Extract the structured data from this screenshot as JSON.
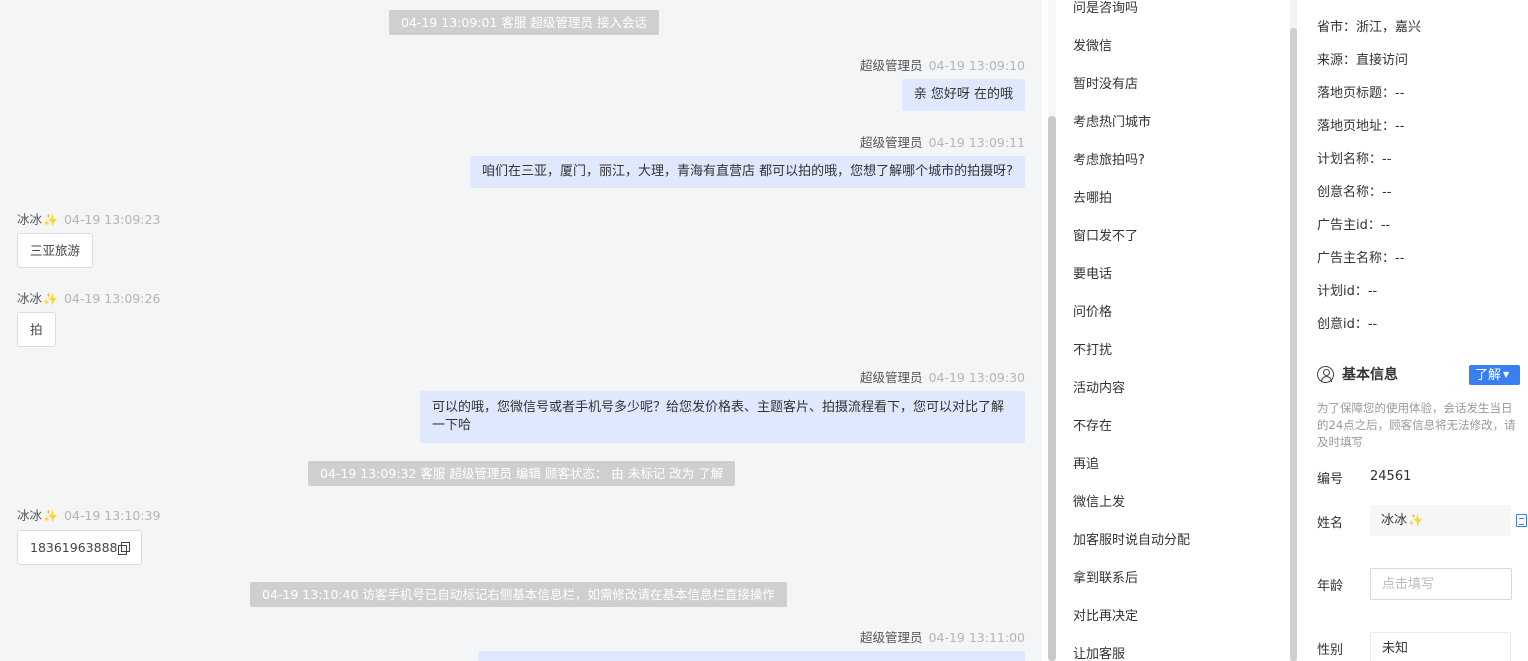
{
  "chat": {
    "sys1": "04-19 13:09:01 客服 超级管理员 接入会话",
    "m1": {
      "sender": "超级管理员",
      "time": "04-19 13:09:10",
      "text": "亲 您好呀 在的哦"
    },
    "m2": {
      "sender": "超级管理员",
      "time": "04-19 13:09:11",
      "text": "咱们在三亚，厦门，丽江，大理，青海有直营店 都可以拍的哦，您想了解哪个城市的拍摄呀?"
    },
    "m3": {
      "sender": "冰冰",
      "time": "04-19 13:09:23",
      "text": "三亚旅游"
    },
    "m4": {
      "sender": "冰冰",
      "time": "04-19 13:09:26",
      "text": "拍"
    },
    "m5": {
      "sender": "超级管理员",
      "time": "04-19 13:09:30",
      "text": "可以的哦，您微信号或者手机号多少呢？给您发价格表、主题客片、拍摄流程看下，您可以对比了解一下哈"
    },
    "sys2": "04-19 13:09:32 客服 超级管理员 编辑 顾客状态： 由 未标记 改为 了解",
    "m6": {
      "sender": "冰冰",
      "time": "04-19 13:10:39",
      "text": "18361963888"
    },
    "sys3": "04-19 13:10:40 访客手机号已自动标记右侧基本信息栏，如需修改请在基本信息栏直接操作",
    "m7": {
      "sender": "超级管理员",
      "time": "04-19 13:11:00"
    }
  },
  "quick_replies": [
    "问是咨询吗",
    "发微信",
    "暂时没有店",
    "考虑热门城市",
    "考虑旅拍吗?",
    "去哪拍",
    "窗口发不了",
    "要电话",
    "问价格",
    "不打扰",
    "活动内容",
    "不存在",
    "再追",
    "微信上发",
    "加客服时说自动分配",
    "拿到联系后",
    "对比再决定",
    "让加客服"
  ],
  "info": {
    "rows": [
      "省市：浙江，嘉兴",
      "来源：直接访问",
      "落地页标题：--",
      "落地页地址：--",
      "计划名称：--",
      "创意名称：--",
      "广告主id：--",
      "广告主名称：--",
      "计划id：--",
      "创意id：--"
    ],
    "basic_title": "基本信息",
    "status_tag": "了解",
    "notice": "为了保障您的使用体验，会话发生当日的24点之后，顾客信息将无法修改，请及时填写",
    "id_label": "编号",
    "id_value": "24561",
    "name_label": "姓名",
    "name_value": "冰冰",
    "age_label": "年龄",
    "age_placeholder": "点击填写",
    "gender_label": "性别",
    "gender_value": "未知"
  }
}
